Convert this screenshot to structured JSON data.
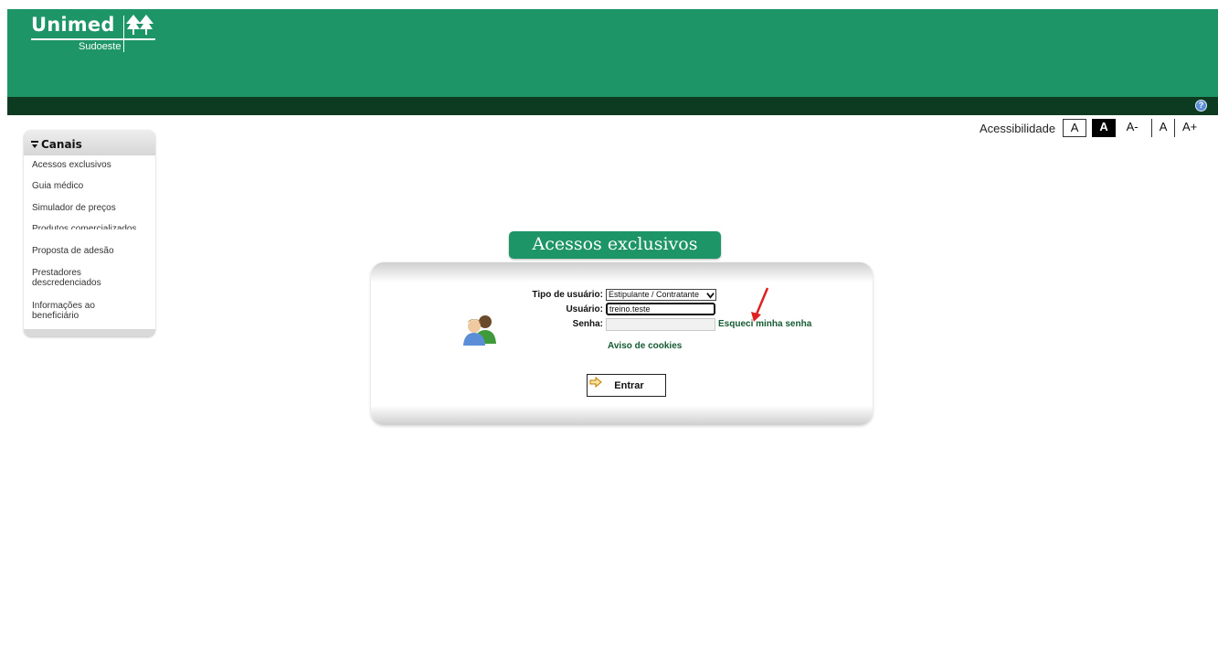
{
  "logo": {
    "name": "Unimed",
    "subtitle": "Sudoeste"
  },
  "accessibility": {
    "label": "Acessibilidade",
    "contrast_normal": "A",
    "contrast_high": "A",
    "font_decrease": "A-",
    "font_normal": "A",
    "font_increase": "A+"
  },
  "sidebar": {
    "title": "Canais",
    "items": [
      {
        "label": "Acessos exclusivos"
      },
      {
        "label": "Guia médico"
      },
      {
        "label": "Simulador de preços"
      },
      {
        "label": "Produtos comercializados"
      },
      {
        "label": "Proposta de adesão"
      },
      {
        "label": "Prestadores descredenciados"
      },
      {
        "label": "Informações ao beneficiário"
      }
    ]
  },
  "login": {
    "title": "Acessos exclusivos",
    "user_type_label": "Tipo de usuário:",
    "user_type_value": "Estipulante / Contratante",
    "username_label": "Usuário:",
    "username_value": "treino.teste",
    "password_label": "Senha:",
    "password_value": "",
    "forgot_password": "Esqueci minha senha",
    "cookies_notice": "Aviso de cookies",
    "submit_label": "Entrar"
  },
  "colors": {
    "brand_green": "#1d9566",
    "header_dark": "#0c3b22",
    "link_green": "#145a32",
    "annotation_red": "#e02020"
  },
  "icons": [
    "help-icon",
    "users-icon",
    "arrow-right-icon",
    "menu-collapse-icon"
  ]
}
